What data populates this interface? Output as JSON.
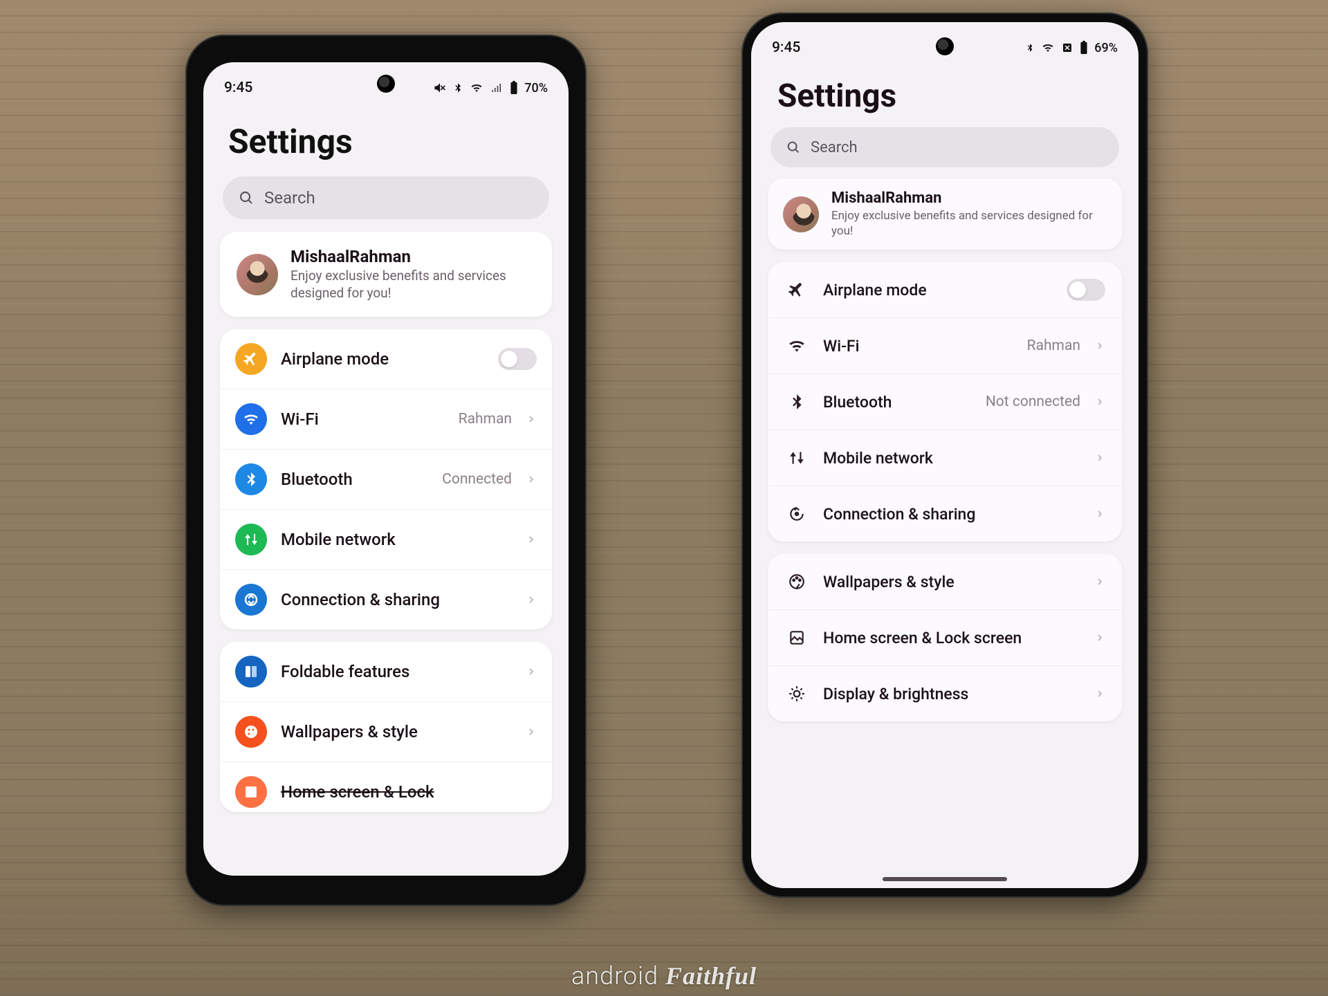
{
  "watermark": {
    "a": "android",
    "b": "Faithful"
  },
  "left": {
    "status": {
      "time": "9:45",
      "battery": "70%"
    },
    "title": "Settings",
    "search": "Search",
    "profile": {
      "name": "MishaalRahman",
      "sub": "Enjoy exclusive benefits and services designed for you!"
    },
    "g1": {
      "airplane": "Airplane mode",
      "wifi": "Wi-Fi",
      "wifi_val": "Rahman",
      "bt": "Bluetooth",
      "bt_val": "Connected",
      "mobile": "Mobile network",
      "conn": "Connection & sharing"
    },
    "g2": {
      "fold": "Foldable features",
      "wall": "Wallpapers & style",
      "home": "Home screen & Lock"
    }
  },
  "right": {
    "status": {
      "time": "9:45",
      "battery": "69%"
    },
    "title": "Settings",
    "search": "Search",
    "profile": {
      "name": "MishaalRahman",
      "sub": "Enjoy exclusive benefits and services designed for you!"
    },
    "g1": {
      "airplane": "Airplane mode",
      "wifi": "Wi-Fi",
      "wifi_val": "Rahman",
      "bt": "Bluetooth",
      "bt_val": "Not connected",
      "mobile": "Mobile network",
      "conn": "Connection & sharing"
    },
    "g2": {
      "wall": "Wallpapers & style",
      "home": "Home screen & Lock screen",
      "disp": "Display & brightness"
    }
  }
}
